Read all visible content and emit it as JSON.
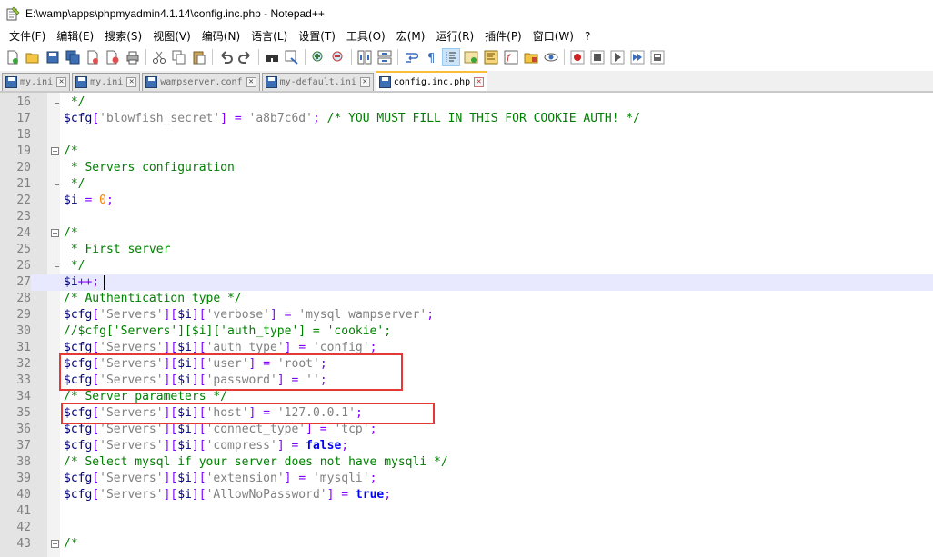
{
  "window": {
    "title": "E:\\wamp\\apps\\phpmyadmin4.1.14\\config.inc.php - Notepad++"
  },
  "menu": [
    {
      "label": "文件(F)"
    },
    {
      "label": "编辑(E)"
    },
    {
      "label": "搜索(S)"
    },
    {
      "label": "视图(V)"
    },
    {
      "label": "编码(N)"
    },
    {
      "label": "语言(L)"
    },
    {
      "label": "设置(T)"
    },
    {
      "label": "工具(O)"
    },
    {
      "label": "宏(M)"
    },
    {
      "label": "运行(R)"
    },
    {
      "label": "插件(P)"
    },
    {
      "label": "窗口(W)"
    },
    {
      "label": "?"
    }
  ],
  "tabs": [
    {
      "label": "my.ini",
      "active": false
    },
    {
      "label": "my.ini",
      "active": false
    },
    {
      "label": "wampserver.conf",
      "active": false
    },
    {
      "label": "my-default.ini",
      "active": false
    },
    {
      "label": "config.inc.php",
      "active": true
    }
  ],
  "editor": {
    "current_line": 27,
    "lines": [
      {
        "n": "16",
        "parts": [
          [
            "c-com",
            " */"
          ]
        ]
      },
      {
        "n": "17",
        "parts": [
          [
            "c-var",
            "$cfg"
          ],
          [
            "c-op",
            "["
          ],
          [
            "c-str",
            "'blowfish_secret'"
          ],
          [
            "c-op",
            "]"
          ],
          [
            "c-punc",
            " "
          ],
          [
            "c-op",
            "="
          ],
          [
            "c-punc",
            " "
          ],
          [
            "c-str",
            "'a8b7c6d'"
          ],
          [
            "c-op",
            ";"
          ],
          [
            "c-punc",
            " "
          ],
          [
            "c-com",
            "/* YOU MUST FILL IN THIS FOR COOKIE AUTH! */"
          ]
        ]
      },
      {
        "n": "18",
        "parts": []
      },
      {
        "n": "19",
        "parts": [
          [
            "c-com",
            "/*"
          ]
        ]
      },
      {
        "n": "20",
        "parts": [
          [
            "c-com",
            " * Servers configuration"
          ]
        ]
      },
      {
        "n": "21",
        "parts": [
          [
            "c-com",
            " */"
          ]
        ]
      },
      {
        "n": "22",
        "parts": [
          [
            "c-var",
            "$i"
          ],
          [
            "c-punc",
            " "
          ],
          [
            "c-op",
            "="
          ],
          [
            "c-punc",
            " "
          ],
          [
            "c-num",
            "0"
          ],
          [
            "c-op",
            ";"
          ]
        ]
      },
      {
        "n": "23",
        "parts": []
      },
      {
        "n": "24",
        "parts": [
          [
            "c-com",
            "/*"
          ]
        ]
      },
      {
        "n": "25",
        "parts": [
          [
            "c-com",
            " * First server"
          ]
        ]
      },
      {
        "n": "26",
        "parts": [
          [
            "c-com",
            " */"
          ]
        ]
      },
      {
        "n": "27",
        "parts": [
          [
            "c-var",
            "$i"
          ],
          [
            "c-op",
            "++;"
          ]
        ]
      },
      {
        "n": "28",
        "parts": [
          [
            "c-com",
            "/* Authentication type */"
          ]
        ]
      },
      {
        "n": "29",
        "parts": [
          [
            "c-var",
            "$cfg"
          ],
          [
            "c-op",
            "["
          ],
          [
            "c-str",
            "'Servers'"
          ],
          [
            "c-op",
            "]["
          ],
          [
            "c-var",
            "$i"
          ],
          [
            "c-op",
            "]["
          ],
          [
            "c-str",
            "'verbose'"
          ],
          [
            "c-op",
            "]"
          ],
          [
            "c-punc",
            " "
          ],
          [
            "c-op",
            "="
          ],
          [
            "c-punc",
            " "
          ],
          [
            "c-str",
            "'mysql wampserver'"
          ],
          [
            "c-op",
            ";"
          ]
        ]
      },
      {
        "n": "30",
        "parts": [
          [
            "c-com",
            "//$cfg['Servers'][$i]['auth_type'] = 'cookie';"
          ]
        ]
      },
      {
        "n": "31",
        "parts": [
          [
            "c-var",
            "$cfg"
          ],
          [
            "c-op",
            "["
          ],
          [
            "c-str",
            "'Servers'"
          ],
          [
            "c-op",
            "]["
          ],
          [
            "c-var",
            "$i"
          ],
          [
            "c-op",
            "]["
          ],
          [
            "c-str",
            "'auth_type'"
          ],
          [
            "c-op",
            "]"
          ],
          [
            "c-punc",
            " "
          ],
          [
            "c-op",
            "="
          ],
          [
            "c-punc",
            " "
          ],
          [
            "c-str",
            "'config'"
          ],
          [
            "c-op",
            ";"
          ]
        ]
      },
      {
        "n": "32",
        "parts": [
          [
            "c-var",
            "$cfg"
          ],
          [
            "c-op",
            "["
          ],
          [
            "c-str",
            "'Servers'"
          ],
          [
            "c-op",
            "]["
          ],
          [
            "c-var",
            "$i"
          ],
          [
            "c-op",
            "]["
          ],
          [
            "c-str",
            "'user'"
          ],
          [
            "c-op",
            "]"
          ],
          [
            "c-punc",
            " "
          ],
          [
            "c-op",
            "="
          ],
          [
            "c-punc",
            " "
          ],
          [
            "c-str",
            "'root'"
          ],
          [
            "c-op",
            ";"
          ]
        ]
      },
      {
        "n": "33",
        "parts": [
          [
            "c-var",
            "$cfg"
          ],
          [
            "c-op",
            "["
          ],
          [
            "c-str",
            "'Servers'"
          ],
          [
            "c-op",
            "]["
          ],
          [
            "c-var",
            "$i"
          ],
          [
            "c-op",
            "]["
          ],
          [
            "c-str",
            "'password'"
          ],
          [
            "c-op",
            "]"
          ],
          [
            "c-punc",
            " "
          ],
          [
            "c-op",
            "="
          ],
          [
            "c-punc",
            " "
          ],
          [
            "c-str",
            "''"
          ],
          [
            "c-op",
            ";"
          ]
        ]
      },
      {
        "n": "34",
        "parts": [
          [
            "c-com",
            "/* Server parameters */"
          ]
        ]
      },
      {
        "n": "35",
        "parts": [
          [
            "c-var",
            "$cfg"
          ],
          [
            "c-op",
            "["
          ],
          [
            "c-str",
            "'Servers'"
          ],
          [
            "c-op",
            "]["
          ],
          [
            "c-var",
            "$i"
          ],
          [
            "c-op",
            "]["
          ],
          [
            "c-str",
            "'host'"
          ],
          [
            "c-op",
            "]"
          ],
          [
            "c-punc",
            " "
          ],
          [
            "c-op",
            "="
          ],
          [
            "c-punc",
            " "
          ],
          [
            "c-str",
            "'127.0.0.1'"
          ],
          [
            "c-op",
            ";"
          ]
        ]
      },
      {
        "n": "36",
        "parts": [
          [
            "c-var",
            "$cfg"
          ],
          [
            "c-op",
            "["
          ],
          [
            "c-str",
            "'Servers'"
          ],
          [
            "c-op",
            "]["
          ],
          [
            "c-var",
            "$i"
          ],
          [
            "c-op",
            "]["
          ],
          [
            "c-str",
            "'connect_type'"
          ],
          [
            "c-op",
            "]"
          ],
          [
            "c-punc",
            " "
          ],
          [
            "c-op",
            "="
          ],
          [
            "c-punc",
            " "
          ],
          [
            "c-str",
            "'tcp'"
          ],
          [
            "c-op",
            ";"
          ]
        ]
      },
      {
        "n": "37",
        "parts": [
          [
            "c-var",
            "$cfg"
          ],
          [
            "c-op",
            "["
          ],
          [
            "c-str",
            "'Servers'"
          ],
          [
            "c-op",
            "]["
          ],
          [
            "c-var",
            "$i"
          ],
          [
            "c-op",
            "]["
          ],
          [
            "c-str",
            "'compress'"
          ],
          [
            "c-op",
            "]"
          ],
          [
            "c-punc",
            " "
          ],
          [
            "c-op",
            "="
          ],
          [
            "c-punc",
            " "
          ],
          [
            "c-kw",
            "false"
          ],
          [
            "c-op",
            ";"
          ]
        ]
      },
      {
        "n": "38",
        "parts": [
          [
            "c-com",
            "/* Select mysql if your server does not have mysqli */"
          ]
        ]
      },
      {
        "n": "39",
        "parts": [
          [
            "c-var",
            "$cfg"
          ],
          [
            "c-op",
            "["
          ],
          [
            "c-str",
            "'Servers'"
          ],
          [
            "c-op",
            "]["
          ],
          [
            "c-var",
            "$i"
          ],
          [
            "c-op",
            "]["
          ],
          [
            "c-str",
            "'extension'"
          ],
          [
            "c-op",
            "]"
          ],
          [
            "c-punc",
            " "
          ],
          [
            "c-op",
            "="
          ],
          [
            "c-punc",
            " "
          ],
          [
            "c-str",
            "'mysqli'"
          ],
          [
            "c-op",
            ";"
          ]
        ]
      },
      {
        "n": "40",
        "parts": [
          [
            "c-var",
            "$cfg"
          ],
          [
            "c-op",
            "["
          ],
          [
            "c-str",
            "'Servers'"
          ],
          [
            "c-op",
            "]["
          ],
          [
            "c-var",
            "$i"
          ],
          [
            "c-op",
            "]["
          ],
          [
            "c-str",
            "'AllowNoPassword'"
          ],
          [
            "c-op",
            "]"
          ],
          [
            "c-punc",
            " "
          ],
          [
            "c-op",
            "="
          ],
          [
            "c-punc",
            " "
          ],
          [
            "c-kw",
            "true"
          ],
          [
            "c-op",
            ";"
          ]
        ]
      },
      {
        "n": "41",
        "parts": []
      },
      {
        "n": "42",
        "parts": []
      },
      {
        "n": "43",
        "parts": [
          [
            "c-com",
            "/*"
          ]
        ]
      }
    ]
  },
  "colors": {
    "highlight_box": "#e53935",
    "current_line_bg": "#e8e8ff",
    "gutter_bg": "#e4e4e4",
    "active_tab_accent": "#fabd3a"
  }
}
